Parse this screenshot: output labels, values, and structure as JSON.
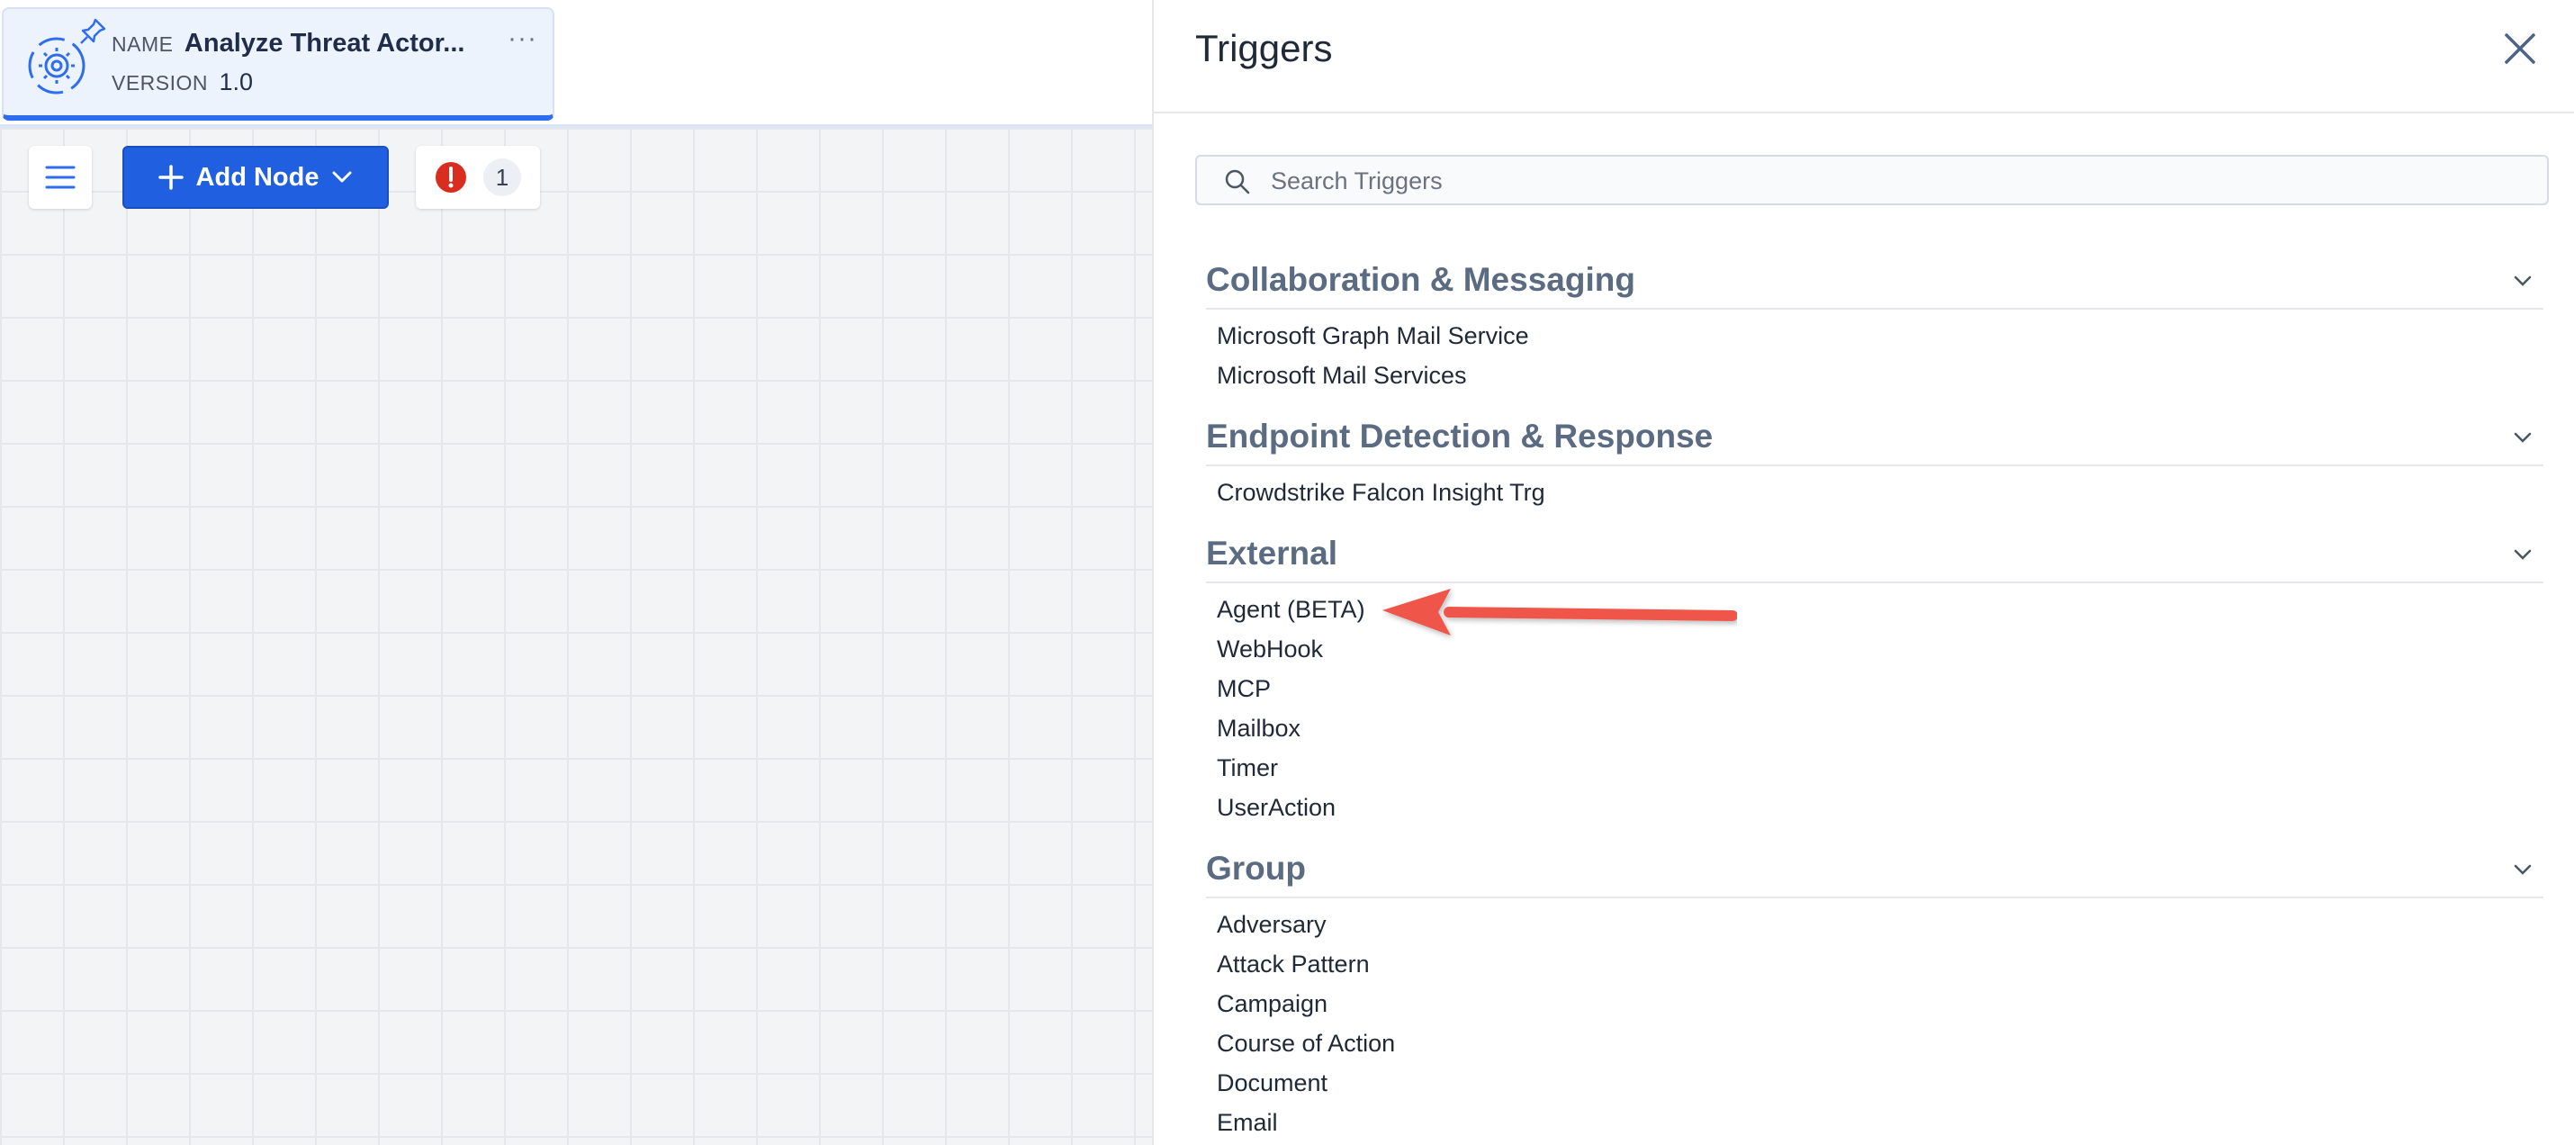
{
  "workflow": {
    "name_label": "NAME",
    "name": "Analyze Threat Actor...",
    "version_label": "VERSION",
    "version": "1.0",
    "more": "···"
  },
  "toolbar": {
    "add_node_label": "Add Node",
    "error_count": "1"
  },
  "panel": {
    "title": "Triggers",
    "search_placeholder": "Search Triggers",
    "categories": [
      {
        "title": "Collaboration & Messaging",
        "items": [
          "Microsoft Graph Mail Service",
          "Microsoft Mail Services"
        ]
      },
      {
        "title": "Endpoint Detection & Response",
        "items": [
          "Crowdstrike Falcon Insight Trg"
        ]
      },
      {
        "title": "External",
        "items": [
          "Agent (BETA)",
          "WebHook",
          "MCP",
          "Mailbox",
          "Timer",
          "UserAction"
        ]
      },
      {
        "title": "Group",
        "items": [
          "Adversary",
          "Attack Pattern",
          "Campaign",
          "Course of Action",
          "Document",
          "Email"
        ]
      }
    ]
  },
  "colors": {
    "accent": "#1f5fe0",
    "error": "#d92d20",
    "annotation_arrow": "#f0554a",
    "category_text": "#5b6b82"
  },
  "icons": [
    "workflow-gear-icon",
    "pin-icon",
    "more-icon",
    "menu-icon",
    "plus-icon",
    "chevron-down-icon",
    "error-icon",
    "close-icon",
    "search-icon"
  ]
}
